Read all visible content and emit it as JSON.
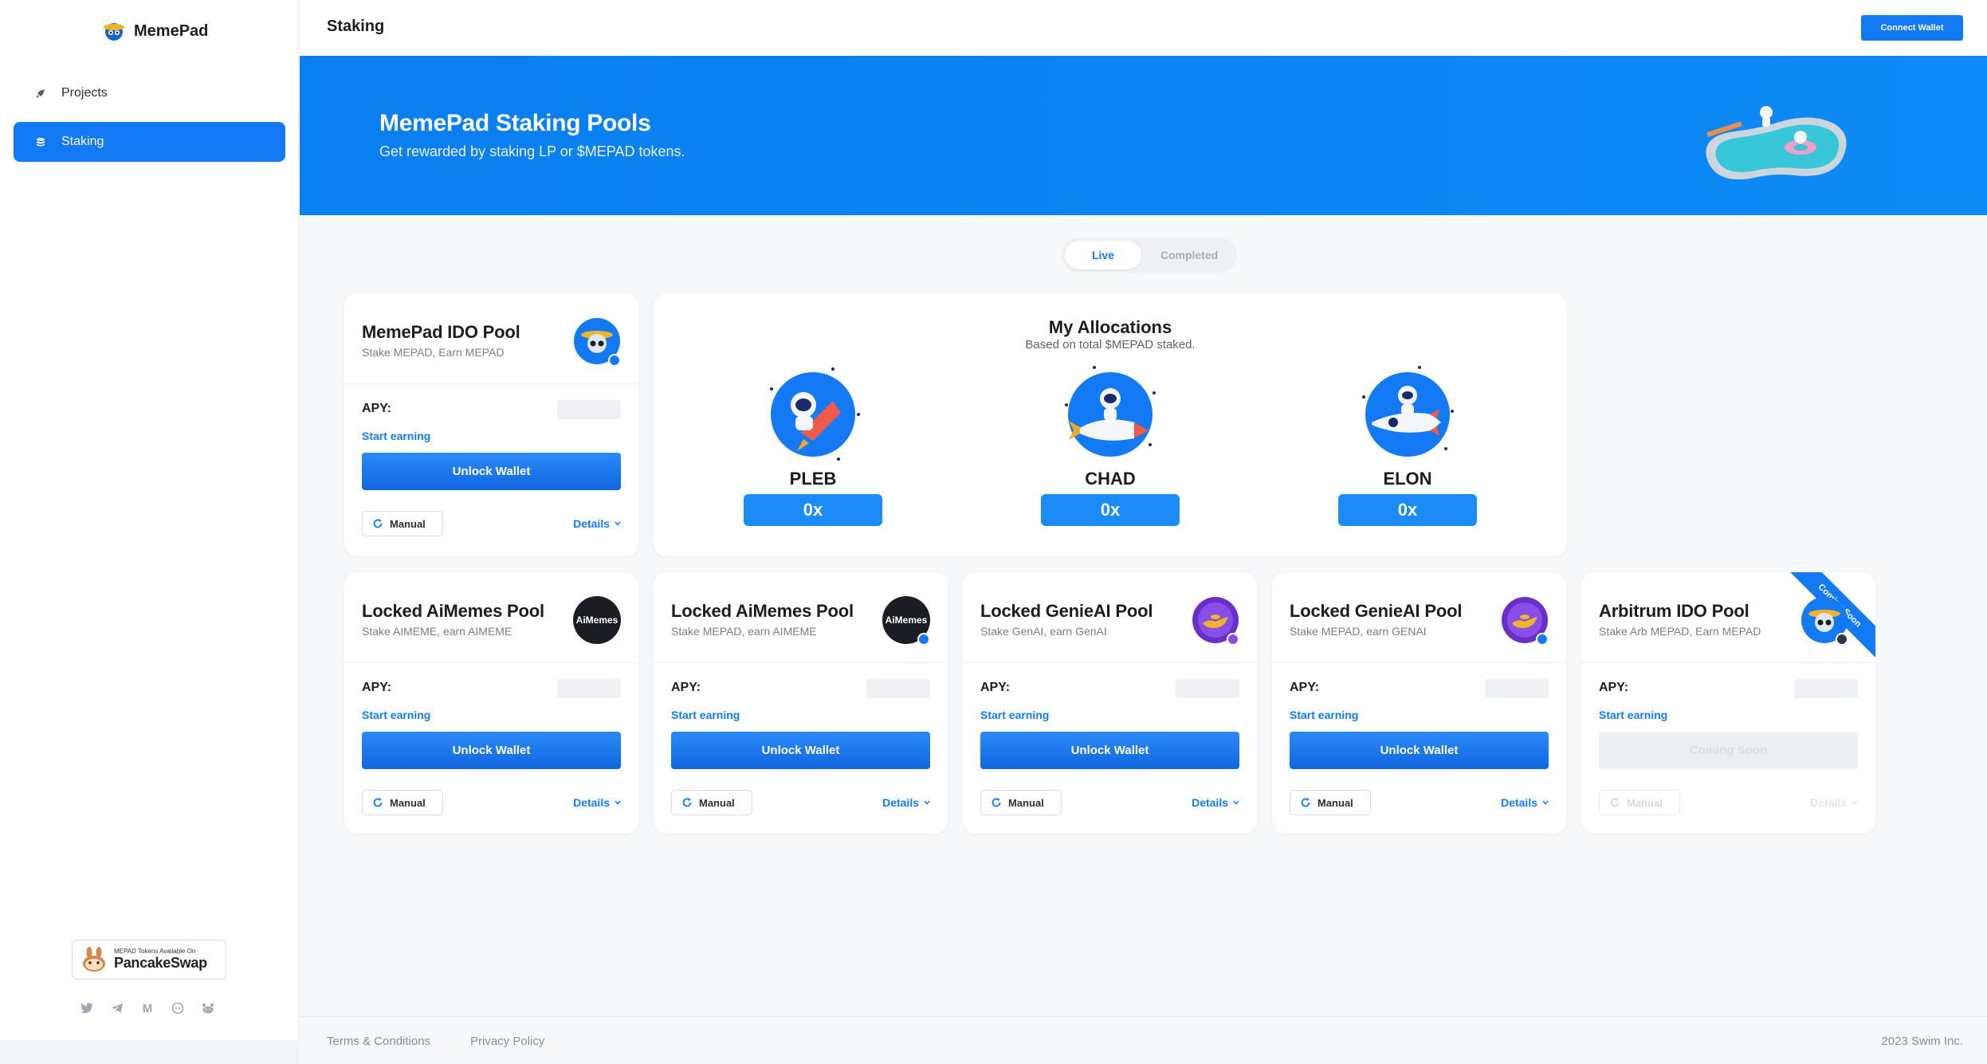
{
  "sidebar": {
    "logo_text": "MemePad",
    "items": [
      {
        "label": "Projects",
        "icon": "rocket-icon"
      },
      {
        "label": "Staking",
        "icon": "coins-icon",
        "active": true
      }
    ],
    "pancake_small": "MEPAD Tokens Available On",
    "pancake_big": "PancakeSwap",
    "socials": [
      "twitter-icon",
      "telegram-icon",
      "medium-icon",
      "discord-icon",
      "reddit-icon"
    ],
    "medium_glyph": "M"
  },
  "topbar": {
    "title": "Staking",
    "connect_label": "Connect Wallet"
  },
  "hero": {
    "title": "MemePad Staking Pools",
    "subtitle": "Get rewarded by staking LP or $MEPAD tokens."
  },
  "toggle": {
    "live": "Live",
    "completed": "Completed",
    "selected": "Live"
  },
  "labels": {
    "apy": "APY:",
    "start": "Start earning",
    "unlock": "Unlock Wallet",
    "manual": "Manual",
    "details": "Details",
    "coming_soon": "Coming Soon"
  },
  "pools": [
    {
      "title": "MemePad IDO Pool",
      "subtitle": "Stake MEPAD, Earn MEPAD",
      "avatar": "astronaut-logo"
    },
    {
      "title": "Locked AiMemes Pool",
      "subtitle": "Stake AIMEME, earn AIMEME",
      "avatar": "aimemes-logo",
      "avatar_text": "AiMemes"
    },
    {
      "title": "Locked AiMemes Pool",
      "subtitle": "Stake MEPAD, earn AIMEME",
      "avatar": "aimemes-logo",
      "avatar_text": "AiMemes"
    },
    {
      "title": "Locked GenieAI Pool",
      "subtitle": "Stake GenAI, earn GenAI",
      "avatar": "genie-lamp-logo"
    },
    {
      "title": "Locked GenieAI Pool",
      "subtitle": "Stake MEPAD, earn GENAI",
      "avatar": "genie-lamp-logo"
    },
    {
      "title": "Arbitrum IDO Pool",
      "subtitle": "Stake Arb MEPAD, Earn MEPAD",
      "avatar": "astronaut-logo",
      "ribbon": "Coming Soon",
      "button": "Coming Soon",
      "disabled": true
    }
  ],
  "allocations": {
    "title": "My Allocations",
    "subtitle": "Based on total $MEPAD staked.",
    "tiers": [
      {
        "name": "PLEB",
        "value": "0x"
      },
      {
        "name": "CHAD",
        "value": "0x"
      },
      {
        "name": "ELON",
        "value": "0x"
      }
    ]
  },
  "footer": {
    "terms": "Terms & Conditions",
    "privacy": "Privacy Policy",
    "copyright": "2023 Swim Inc."
  },
  "colors": {
    "accent": "#1479f5",
    "hero": "#0a7ff0",
    "tier": "#1a8bf7"
  }
}
